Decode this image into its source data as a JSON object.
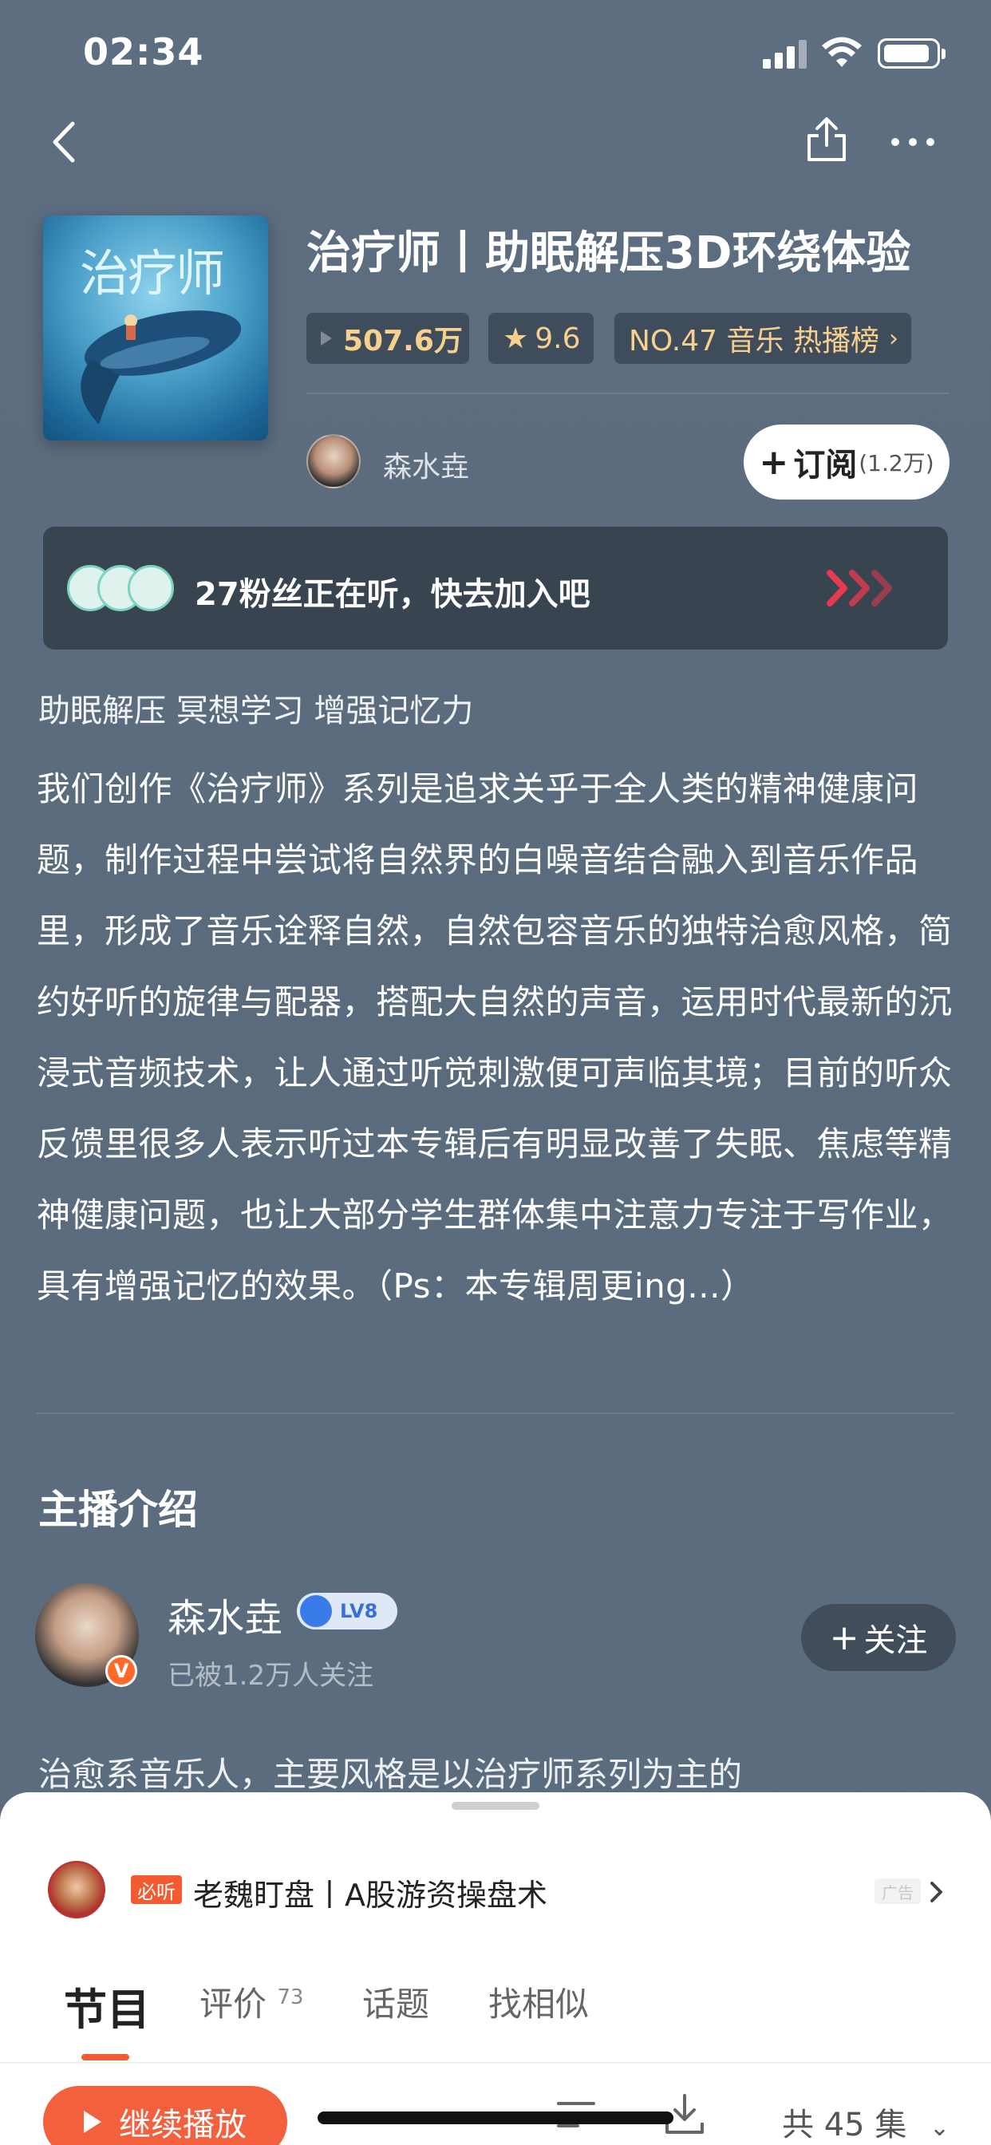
{
  "status_bar": {
    "time": "02:34"
  },
  "album": {
    "title": "治疗师丨助眠解压3D环绕体验",
    "cover_text": "治疗师",
    "plays": "507.6万",
    "rating": "9.6",
    "rank_label": "NO.47 音乐 热播榜",
    "author": "森水垚",
    "subscribe_label": "订阅",
    "subscribe_count": "(1.2万)"
  },
  "fans_banner": {
    "text": "27粉丝正在听，快去加入吧"
  },
  "tags_line": "助眠解压 冥想学习 增强记忆力",
  "description": "我们创作《治疗师》系列是追求关乎于全人类的精神健康问题，制作过程中尝试将自然界的白噪音结合融入到音乐作品里，形成了音乐诠释自然，自然包容音乐的独特治愈风格，简约好听的旋律与配器，搭配大自然的声音，运用时代最新的沉浸式音频技术，让人通过听觉刺激便可声临其境；目前的听众反馈里很多人表示听过本专辑后有明显改善了失眠、焦虑等精神健康问题，也让大部分学生群体集中注意力专注于写作业，具有增强记忆的效果。（Ps：本专辑周更ing...）",
  "host_section": {
    "title": "主播介绍",
    "name": "森水垚",
    "level": "LV8",
    "followers": "已被1.2万人关注",
    "follow_label": "关注",
    "bio": "治愈系音乐人，主要风格是以治疗师系列为主的"
  },
  "sheet": {
    "ad": {
      "badge": "必听",
      "title": "老魏盯盘丨A股游资操盘术",
      "label": "广告"
    },
    "tabs": [
      {
        "label": "节目"
      },
      {
        "label": "评价",
        "count": "73"
      },
      {
        "label": "话题"
      },
      {
        "label": "找相似"
      }
    ],
    "play_label": "继续播放",
    "episodes": "共 45 集"
  }
}
